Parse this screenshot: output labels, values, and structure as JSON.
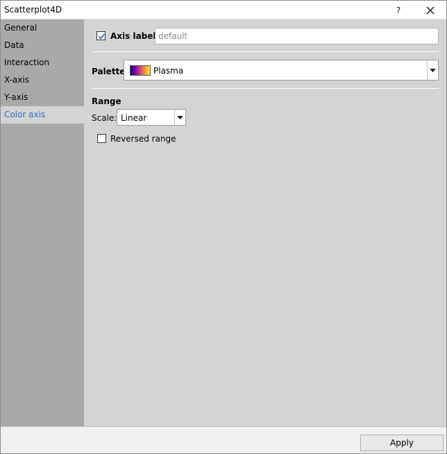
{
  "window": {
    "title": "Scatterplot4D",
    "help_label": "?"
  },
  "sidebar": {
    "items": [
      {
        "label": "General"
      },
      {
        "label": "Data"
      },
      {
        "label": "Interaction"
      },
      {
        "label": "X-axis"
      },
      {
        "label": "Y-axis"
      },
      {
        "label": "Color axis",
        "active": true
      }
    ]
  },
  "axis_label": {
    "checkbox_label": "Axis label",
    "checked": true,
    "placeholder": "default",
    "value": ""
  },
  "palette": {
    "label": "Palette",
    "selected": "Plasma",
    "swatch_colors": [
      "#0d0887",
      "#7e03a8",
      "#cc4778",
      "#f89540",
      "#f0f921"
    ]
  },
  "range": {
    "heading": "Range",
    "scale_label": "Scale:",
    "scale_selected": "Linear",
    "reversed_label": "Reversed range",
    "reversed_checked": false
  },
  "footer": {
    "apply_label": "Apply"
  }
}
